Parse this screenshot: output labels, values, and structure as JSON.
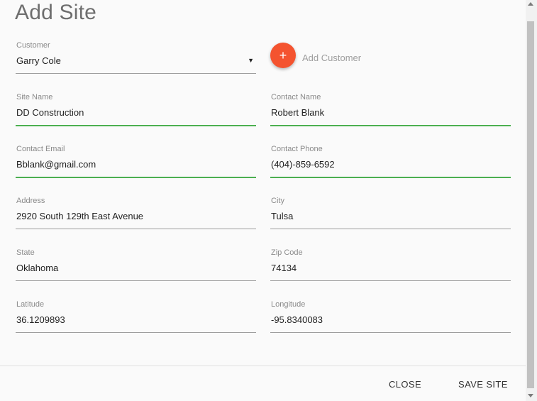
{
  "dialog": {
    "title": "Add Site",
    "customer": {
      "label": "Customer",
      "value": "Garry Cole"
    },
    "add_customer": {
      "icon": "+",
      "label": "Add Customer"
    },
    "fields": {
      "site_name": {
        "label": "Site Name",
        "value": "DD Construction"
      },
      "contact_name": {
        "label": "Contact Name",
        "value": "Robert Blank"
      },
      "contact_email": {
        "label": "Contact Email",
        "value": "Bblank@gmail.com"
      },
      "contact_phone": {
        "label": "Contact Phone",
        "value": "(404)-859-6592"
      },
      "address": {
        "label": "Address",
        "value": "2920 South 129th East Avenue"
      },
      "city": {
        "label": "City",
        "value": "Tulsa"
      },
      "state": {
        "label": "State",
        "value": "Oklahoma"
      },
      "zip": {
        "label": "Zip Code",
        "value": "74134"
      },
      "latitude": {
        "label": "Latitude",
        "value": "36.1209893"
      },
      "longitude": {
        "label": "Longitude",
        "value": "-95.8340083"
      }
    },
    "actions": {
      "close_label": "CLOSE",
      "save_label": "SAVE SITE"
    }
  },
  "colors": {
    "accent_fab": "#f4532f",
    "valid_underline": "#4caf50",
    "underline": "#9e9e9e"
  }
}
